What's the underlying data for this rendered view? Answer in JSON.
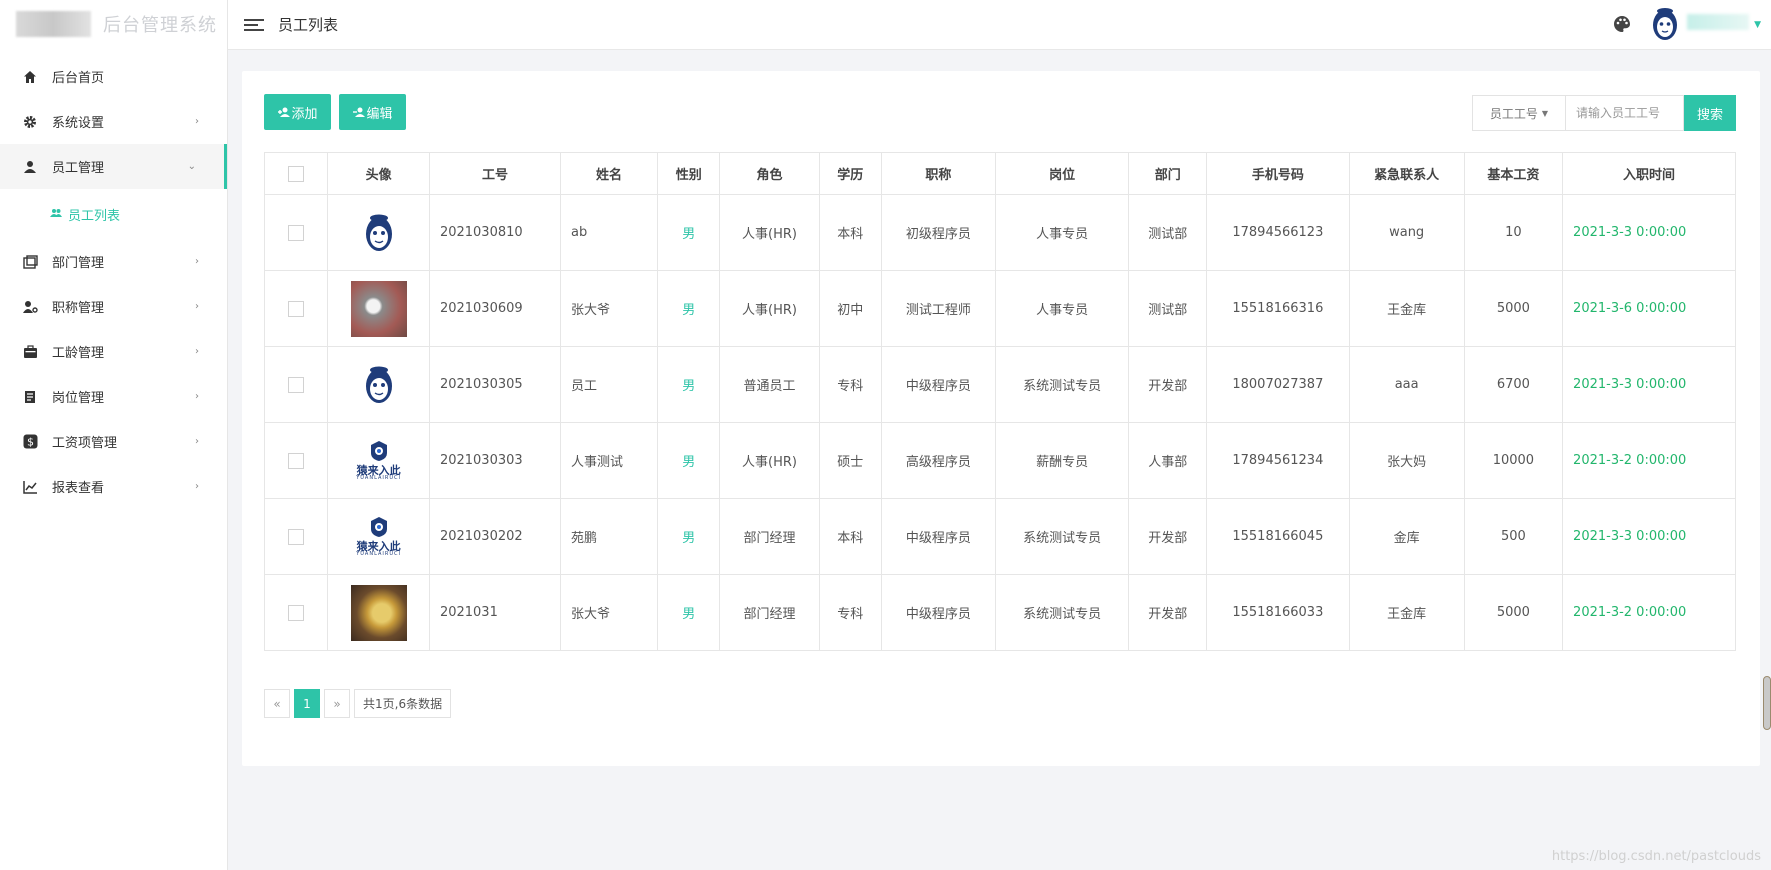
{
  "app": {
    "title": "后台管理系统"
  },
  "sidebar": {
    "items": [
      {
        "label": "后台首页",
        "icon": "home-icon",
        "has_arrow": false
      },
      {
        "label": "系统设置",
        "icon": "gear-icon",
        "has_arrow": true
      },
      {
        "label": "员工管理",
        "icon": "user-icon",
        "has_arrow": true,
        "open": true
      },
      {
        "label": "部门管理",
        "icon": "department-icon",
        "has_arrow": true
      },
      {
        "label": "职称管理",
        "icon": "user-settings-icon",
        "has_arrow": true
      },
      {
        "label": "工龄管理",
        "icon": "briefcase-icon",
        "has_arrow": true
      },
      {
        "label": "岗位管理",
        "icon": "document-icon",
        "has_arrow": true
      },
      {
        "label": "工资项管理",
        "icon": "dollar-icon",
        "has_arrow": true
      },
      {
        "label": "报表查看",
        "icon": "chart-icon",
        "has_arrow": true
      }
    ],
    "sub_item": {
      "label": "员工列表",
      "icon": "users-icon"
    }
  },
  "topbar": {
    "breadcrumb": "员工列表"
  },
  "toolbar": {
    "add_label": "添加",
    "edit_label": "编辑",
    "search_field": "员工工号",
    "search_placeholder": "请输入员工工号",
    "search_button": "搜索"
  },
  "table": {
    "headers": [
      "头像",
      "工号",
      "姓名",
      "性别",
      "角色",
      "学历",
      "职称",
      "岗位",
      "部门",
      "手机号码",
      "紧急联系人",
      "基本工资",
      "入职时间"
    ],
    "rows": [
      {
        "avatar": "monkey",
        "id": "2021030810",
        "name": "ab",
        "gender": "男",
        "role": "人事(HR)",
        "edu": "本科",
        "title": "初级程序员",
        "post": "人事专员",
        "dept": "测试部",
        "phone": "17894566123",
        "contact": "wang",
        "salary": "10",
        "date": "2021-3-3 0:00:00"
      },
      {
        "avatar": "photo-car",
        "id": "2021030609",
        "name": "张大爷",
        "gender": "男",
        "role": "人事(HR)",
        "edu": "初中",
        "title": "测试工程师",
        "post": "人事专员",
        "dept": "测试部",
        "phone": "15518166316",
        "contact": "王金库",
        "salary": "5000",
        "date": "2021-3-6 0:00:00"
      },
      {
        "avatar": "monkey",
        "id": "2021030305",
        "name": "员工",
        "gender": "男",
        "role": "普通员工",
        "edu": "专科",
        "title": "中级程序员",
        "post": "系统测试专员",
        "dept": "开发部",
        "phone": "18007027387",
        "contact": "aaa",
        "salary": "6700",
        "date": "2021-3-3 0:00:00"
      },
      {
        "avatar": "logo",
        "id": "2021030303",
        "name": "人事测试",
        "gender": "男",
        "role": "人事(HR)",
        "edu": "硕士",
        "title": "高级程序员",
        "post": "薪酬专员",
        "dept": "人事部",
        "phone": "17894561234",
        "contact": "张大妈",
        "salary": "10000",
        "date": "2021-3-2 0:00:00"
      },
      {
        "avatar": "logo",
        "id": "2021030202",
        "name": "苑鹏",
        "gender": "男",
        "role": "部门经理",
        "edu": "本科",
        "title": "中级程序员",
        "post": "系统测试专员",
        "dept": "开发部",
        "phone": "15518166045",
        "contact": "金库",
        "salary": "500",
        "date": "2021-3-3 0:00:00"
      },
      {
        "avatar": "photo-gold",
        "id": "2021031",
        "name": "张大爷",
        "gender": "男",
        "role": "部门经理",
        "edu": "专科",
        "title": "中级程序员",
        "post": "系统测试专员",
        "dept": "开发部",
        "phone": "15518166033",
        "contact": "王金库",
        "salary": "5000",
        "date": "2021-3-2 0:00:00"
      }
    ]
  },
  "pagination": {
    "prev": "«",
    "current": "1",
    "next": "»",
    "info": "共1页,6条数据"
  },
  "watermark": "https://blog.csdn.net/pastclouds",
  "logo_image_text": {
    "main": "猿来入此",
    "sub": "YUANLAIRUCI"
  },
  "colors": {
    "accent": "#2ec4a8",
    "date": "#22b66c"
  }
}
